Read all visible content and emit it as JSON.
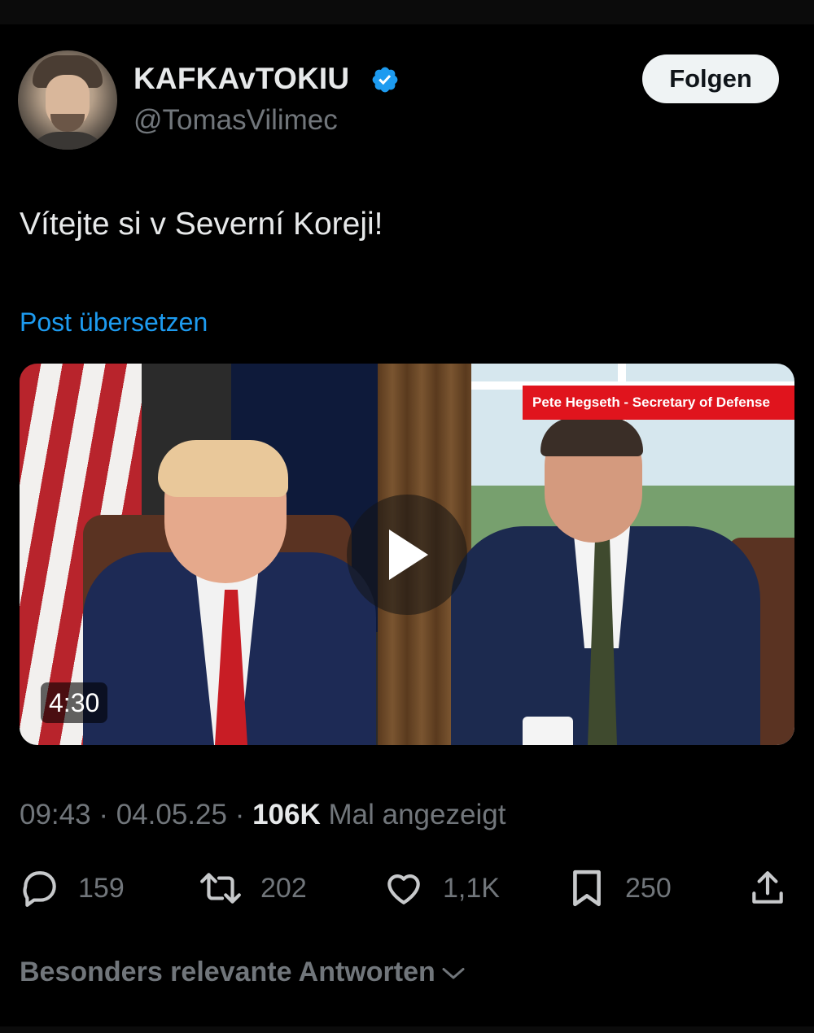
{
  "author": {
    "display_name": "KAFKAvTOKIU",
    "handle": "@TomasVilimec",
    "verified": true
  },
  "follow_button": {
    "label": "Folgen"
  },
  "tweet": {
    "text": "Vítejte si v Severní Koreji!",
    "translate_label": "Post übersetzen"
  },
  "media": {
    "caption": "Pete Hegseth - Secretary of Defense",
    "duration": "4:30"
  },
  "meta": {
    "time": "09:43",
    "separator": "·",
    "date": "04.05.25",
    "views_count": "106K",
    "views_label": "Mal angezeigt"
  },
  "actions": {
    "replies": "159",
    "reposts": "202",
    "likes": "1,1K",
    "bookmarks": "250"
  },
  "replies_sort": {
    "label": "Besonders relevante Antworten"
  },
  "colors": {
    "background": "#000000",
    "accent": "#1d9bf0",
    "muted": "#71767b",
    "text": "#e7e9ea"
  },
  "icons": [
    "verified-badge-icon",
    "play-icon",
    "reply-icon",
    "repost-icon",
    "like-icon",
    "bookmark-icon",
    "share-icon",
    "chevron-down-icon"
  ]
}
